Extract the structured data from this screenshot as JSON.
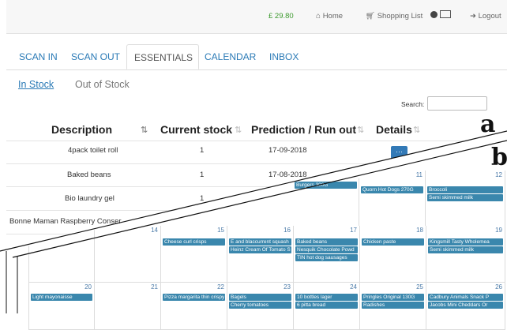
{
  "labels": {
    "a": "a",
    "b": "b"
  },
  "topbar": {
    "balance": "£ 29.80",
    "home": "Home",
    "shopping_list": "Shopping List",
    "logout": "Logout"
  },
  "tabs": [
    "SCAN IN",
    "SCAN OUT",
    "ESSENTIALS",
    "CALENDAR",
    "INBOX"
  ],
  "subtabs": {
    "in_stock": "In Stock",
    "out_of_stock": "Out of Stock"
  },
  "search": {
    "label": "Search:",
    "value": ""
  },
  "table": {
    "headers": [
      "Description",
      "Current stock",
      "Prediction / Run out",
      "Details"
    ],
    "rows": [
      {
        "description": "4pack toilet roll",
        "stock": "1",
        "prediction": "17-09-2018"
      },
      {
        "description": "Baked beans",
        "stock": "1",
        "prediction": "17-08-2018"
      },
      {
        "description": "Bio laundry gel",
        "stock": "1",
        "prediction": ""
      },
      {
        "description": "Bonne Maman Raspberry Conser",
        "stock": "",
        "prediction": ""
      }
    ],
    "details_button": "···"
  },
  "calendar": {
    "top_row": [
      {
        "day": "",
        "events": [
          "Burgers 300G"
        ]
      },
      {
        "day": "11",
        "events": [
          "Quorn Hot Dogs 270G"
        ]
      },
      {
        "day": "12",
        "events": [
          "Broccoli",
          "Semi skimmed milk"
        ]
      }
    ],
    "week2": [
      {
        "day": "14",
        "events": []
      },
      {
        "day": "15",
        "events": [
          "Cheese curl crisps"
        ]
      },
      {
        "day": "16",
        "events": [
          "E and blaccurrent squash",
          "Heinz Cream Of Tomato S"
        ]
      },
      {
        "day": "17",
        "events": [
          "Baked beans",
          "Nesquik Chocolate Powd",
          "TIN hot dog sausages"
        ]
      },
      {
        "day": "18",
        "events": [
          "Chicken paste"
        ]
      },
      {
        "day": "19",
        "events": [
          "Kingsmill Tasty Wholemea",
          "Semi skimmed milk"
        ]
      }
    ],
    "week3": [
      {
        "day": "20",
        "events": [
          "Light mayonaisse"
        ]
      },
      {
        "day": "21",
        "events": []
      },
      {
        "day": "22",
        "events": [
          "Pizza margarita thin crispy"
        ]
      },
      {
        "day": "23",
        "events": [
          "Bagels",
          "Cherry tomatoes"
        ]
      },
      {
        "day": "24",
        "events": [
          "10 bottles lager",
          "6 pitta bread"
        ]
      },
      {
        "day": "25",
        "events": [
          "Pringles Original 130G",
          "Radishes"
        ]
      },
      {
        "day": "26",
        "events": [
          "Cadbury Animals Snack P",
          "Jacobs Mini Cheddars Or"
        ]
      }
    ]
  },
  "colors": {
    "link": "#2a7ab6",
    "price": "#3c9a2e",
    "event": "#3a87ad",
    "button": "#337ab7"
  }
}
